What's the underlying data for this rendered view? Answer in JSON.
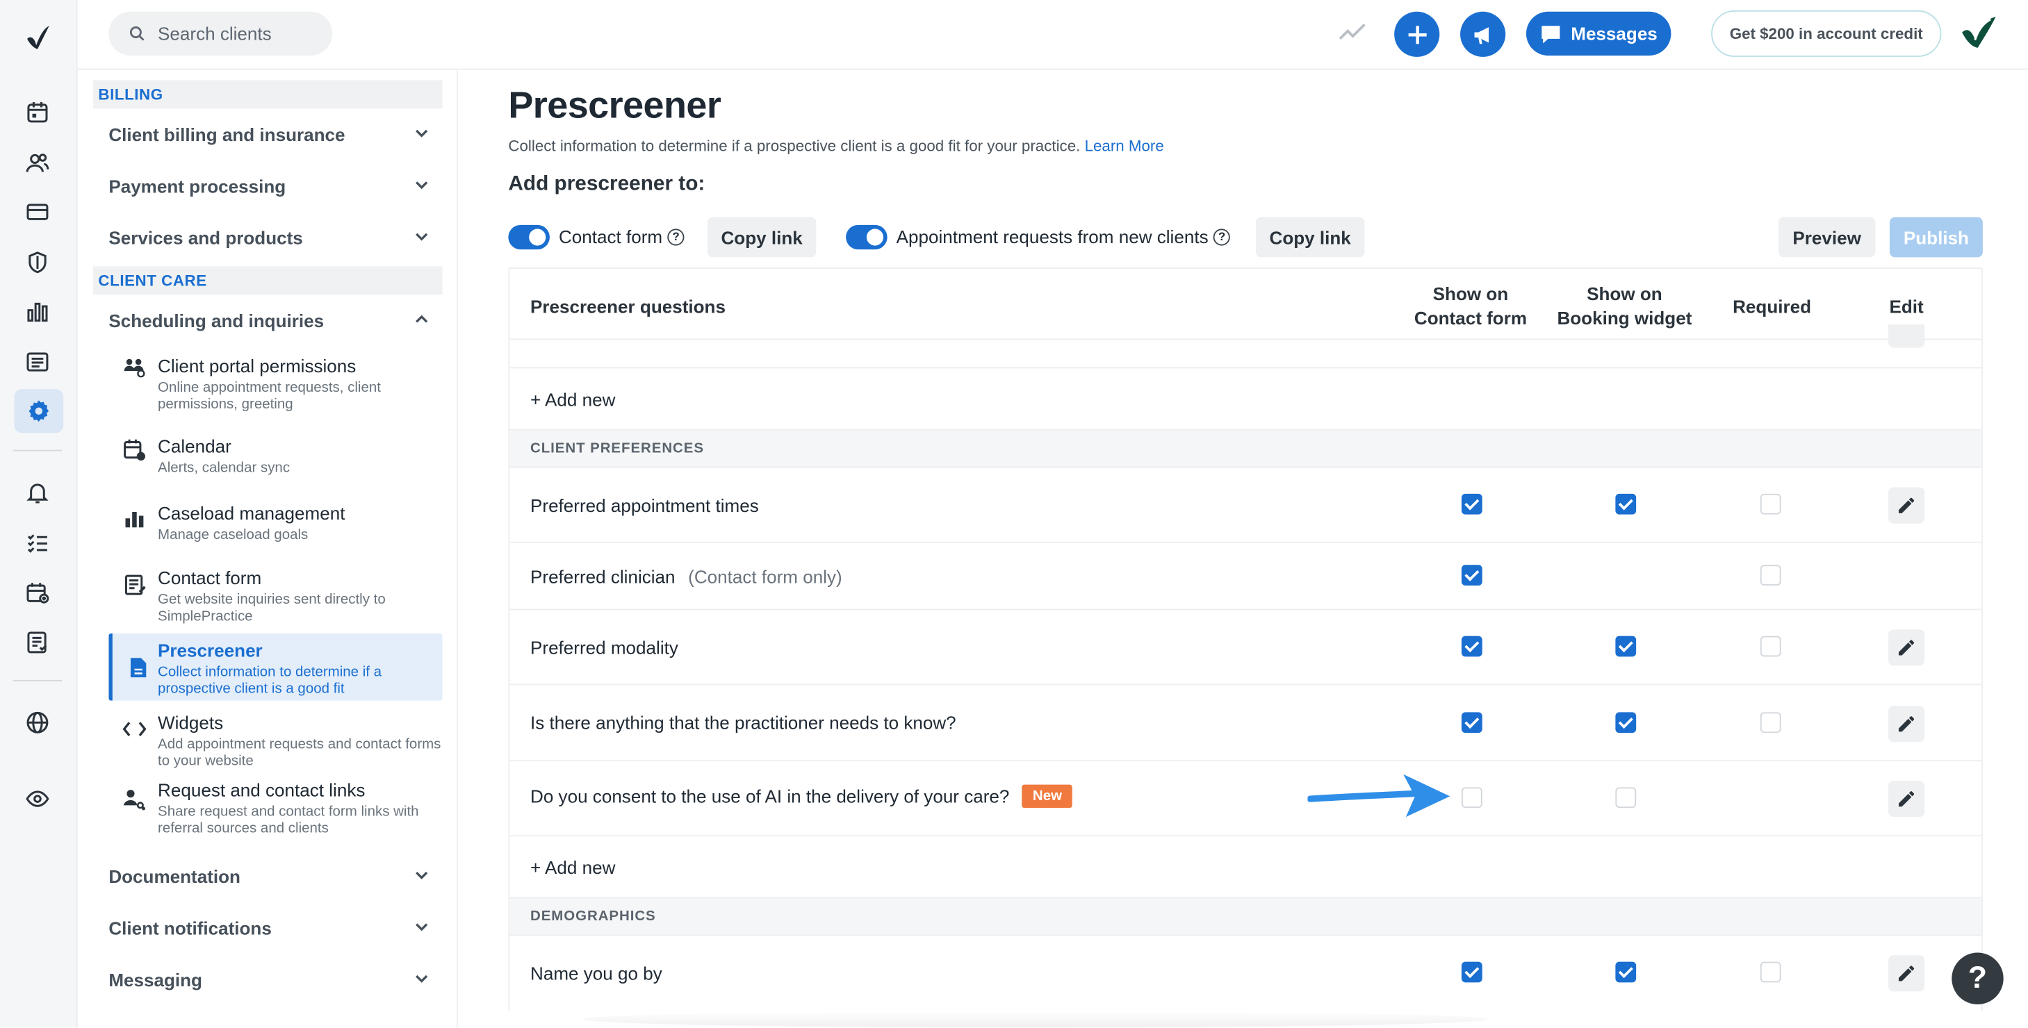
{
  "topbar": {
    "search_placeholder": "Search clients",
    "messages_label": "Messages",
    "credit_label": "Get $200 in account credit"
  },
  "nav": {
    "billing_header": "BILLING",
    "billing_groups": [
      "Client billing and insurance",
      "Payment processing",
      "Services and products"
    ],
    "client_care_header": "CLIENT CARE",
    "scheduling_group": "Scheduling and inquiries",
    "items": [
      {
        "title": "Client portal permissions",
        "desc": "Online appointment requests, client permissions, greeting"
      },
      {
        "title": "Calendar",
        "desc": "Alerts, calendar sync"
      },
      {
        "title": "Caseload management",
        "desc": "Manage caseload goals"
      },
      {
        "title": "Contact form",
        "desc": "Get website inquiries sent directly to SimplePractice"
      },
      {
        "title": "Prescreener",
        "desc": "Collect information to determine if a prospective client is a good fit"
      },
      {
        "title": "Widgets",
        "desc": "Add appointment requests and contact forms to your website"
      },
      {
        "title": "Request and contact links",
        "desc": "Share request and contact form links with referral sources and clients"
      }
    ],
    "bottom_groups": [
      "Documentation",
      "Client notifications",
      "Messaging"
    ]
  },
  "main": {
    "title": "Prescreener",
    "description": "Collect information to determine if a prospective client is a good fit for your practice.",
    "learn_more": "Learn More",
    "add_to_label": "Add prescreener to:",
    "contact_form_toggle": "Contact form",
    "appt_toggle": "Appointment requests from new clients",
    "copy_link": "Copy link",
    "preview": "Preview",
    "publish": "Publish"
  },
  "table": {
    "col_question": "Prescreener questions",
    "col_contact_1": "Show on",
    "col_contact_2": "Contact form",
    "col_booking_1": "Show on",
    "col_booking_2": "Booking widget",
    "col_required": "Required",
    "col_edit": "Edit",
    "add_new": "+ Add new",
    "cat_client_prefs": "CLIENT PREFERENCES",
    "cat_demographics": "DEMOGRAPHICS",
    "rows": [
      {
        "q": "Preferred appointment times",
        "note": "",
        "badge": "",
        "contact": true,
        "booking": true
      },
      {
        "q": "Preferred clinician",
        "note": "(Contact form only)",
        "badge": "",
        "contact": true,
        "booking": null
      },
      {
        "q": "Preferred modality",
        "note": "",
        "badge": "",
        "contact": true,
        "booking": true
      },
      {
        "q": "Is there anything that the practitioner needs to know?",
        "note": "",
        "badge": "",
        "contact": true,
        "booking": true
      },
      {
        "q": "Do you consent to the use of AI in the delivery of your care?",
        "note": "",
        "badge": "New",
        "contact": false,
        "booking": false
      },
      {
        "q": "Name you go by",
        "note": "",
        "badge": "",
        "contact": true,
        "booking": true
      }
    ]
  },
  "help_label": "?"
}
